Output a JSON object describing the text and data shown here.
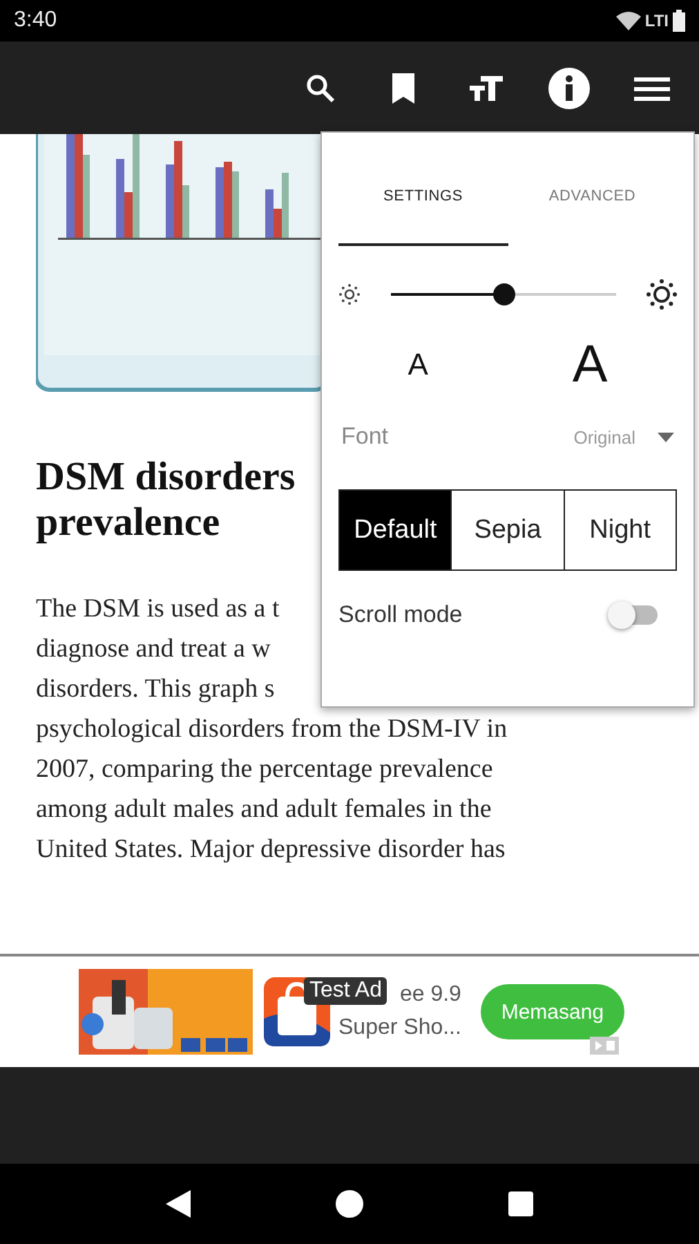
{
  "status_bar": {
    "time": "3:40",
    "network": "LTI"
  },
  "article": {
    "heading_lines": [
      "DSM disorders",
      "prevalence"
    ],
    "paragraph_lines": [
      "The DSM is used as a t",
      "diagnose and treat a w",
      "disorders. This graph s",
      "psychological disorders from the DSM-IV in",
      "2007, comparing the percentage prevalence",
      "among adult males and adult females in the",
      "United States.  Major depressive disorder has"
    ]
  },
  "settings_panel": {
    "tabs": [
      {
        "label": "SETTINGS",
        "selected": true
      },
      {
        "label": "ADVANCED",
        "selected": false
      }
    ],
    "brightness": {
      "level": 0.5
    },
    "text_size": {
      "smaller": "A",
      "larger": "A"
    },
    "font": {
      "label": "Font",
      "value": "Original"
    },
    "themes": [
      {
        "label": "Default",
        "selected": true
      },
      {
        "label": "Sepia",
        "selected": false
      },
      {
        "label": "Night",
        "selected": false
      }
    ],
    "scroll_mode": {
      "label": "Scroll mode",
      "on": false
    }
  },
  "ad": {
    "badge": "Test Ad",
    "title": "ee 9.9",
    "subtitle": "Super Sho...",
    "button": "Memasang"
  }
}
